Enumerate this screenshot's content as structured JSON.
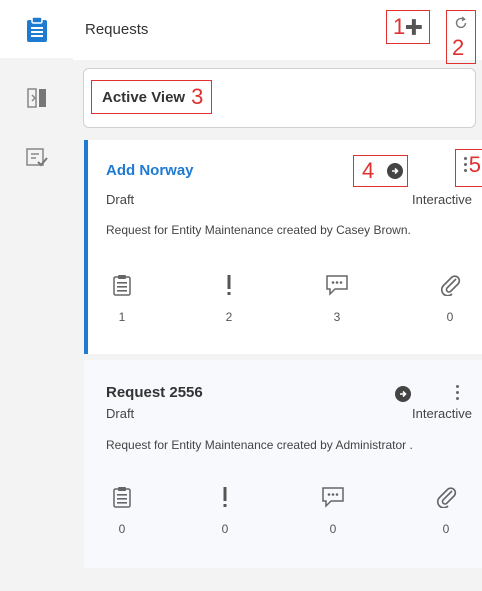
{
  "header": {
    "title": "Requests",
    "add_annotation": "1",
    "refresh_annotation": "2"
  },
  "rail": {
    "items": [
      {
        "icon": "clipboard-icon",
        "active": true
      },
      {
        "icon": "panel-toggle-icon",
        "active": false
      },
      {
        "icon": "approve-list-icon",
        "active": false
      }
    ]
  },
  "view": {
    "label": "Active View",
    "annotation": "3"
  },
  "cards": [
    {
      "title": "Add Norway",
      "status": "Draft",
      "type": "Interactive",
      "description": "Request for Entity Maintenance created by Casey Brown.",
      "go_annotation": "4",
      "menu_annotation": "5",
      "stats": [
        {
          "icon": "clipboard-icon",
          "count": "1"
        },
        {
          "icon": "exclamation-icon",
          "count": "2"
        },
        {
          "icon": "comment-icon",
          "count": "3"
        },
        {
          "icon": "paperclip-icon",
          "count": "0"
        }
      ]
    },
    {
      "title": "Request 2556",
      "status": "Draft",
      "type": "Interactive",
      "description": "Request for Entity Maintenance created by Administrator .",
      "stats": [
        {
          "icon": "clipboard-icon",
          "count": "0"
        },
        {
          "icon": "exclamation-icon",
          "count": "0"
        },
        {
          "icon": "comment-icon",
          "count": "0"
        },
        {
          "icon": "paperclip-icon",
          "count": "0"
        }
      ]
    }
  ],
  "colors": {
    "accent": "#1f7bd1",
    "annotation": "#e03030"
  }
}
